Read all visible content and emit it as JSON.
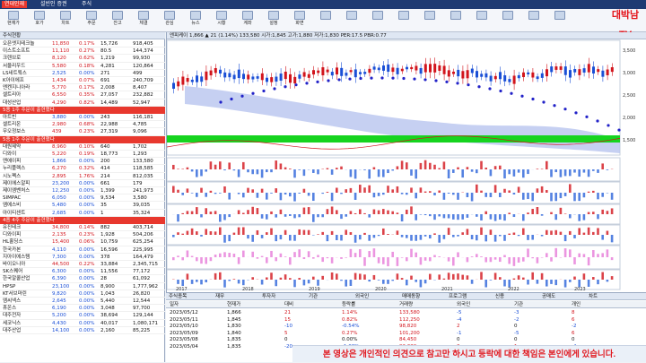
{
  "title_tabs": [
    "연대인재",
    "설빈인 증권",
    "주식",
    "",
    "",
    "",
    "",
    "",
    "",
    ""
  ],
  "toolbar": {
    "items": [
      "현재가",
      "호가",
      "차트",
      "주문",
      "잔고",
      "체결",
      "관심",
      "뉴스",
      "시황",
      "계좌",
      "설정",
      "화면",
      "",
      "",
      "",
      "",
      "",
      "",
      "",
      "",
      "",
      ""
    ]
  },
  "logo": "대박남TV",
  "left_panel": {
    "header": "주식현황",
    "rows": [
      {
        "name": "오픈엣지테크놀",
        "price": "11,850",
        "rate": "0.17%",
        "vol": "15,726",
        "amt": "918,405",
        "dir": "up"
      },
      {
        "name": "이스트소프트",
        "price": "11,110",
        "rate": "0.27%",
        "vol": "80.5",
        "amt": "144,374",
        "dir": "up"
      },
      {
        "name": "크렌브로",
        "price": "8,120",
        "rate": "0.62%",
        "vol": "1,219",
        "amt": "99,930",
        "dir": "up"
      },
      {
        "name": "서울리우드",
        "price": "5,580",
        "rate": "0.18%",
        "vol": "4,281",
        "amt": "120,864",
        "dir": "up"
      },
      {
        "name": "LS네트웍스",
        "price": "2,525",
        "price_dir": "dn",
        "rate": "0.00%",
        "vol": "271",
        "amt": "499",
        "dir": "dn"
      },
      {
        "name": "K아이에프",
        "price": "1,434",
        "rate": "0.07%",
        "vol": "691",
        "amt": "240,709",
        "dir": "up"
      },
      {
        "name": "엔켄지니아라",
        "price": "5,770",
        "rate": "0.17%",
        "vol": "2,008",
        "amt": "8,407",
        "dir": "up"
      },
      {
        "name": "셀트리아",
        "price": "6,550",
        "rate": "0.35%",
        "vol": "27,057",
        "amt": "232,882",
        "dir": "up"
      },
      {
        "name": "대성산업",
        "price": "4,290",
        "rate": "0.82%",
        "vol": "14,489",
        "amt": "52,947",
        "dir": "up"
      }
    ],
    "section1": "5종 1주 주문이 출현했다",
    "rows2": [
      {
        "name": "아트빈",
        "price": "3,880",
        "rate": "0.00%",
        "vol": "243",
        "amt": "116,181",
        "dir": "dn"
      },
      {
        "name": "셀트리온",
        "price": "2,980",
        "rate": "0.68%",
        "vol": "22,988",
        "amt": "4,785",
        "dir": "up"
      },
      {
        "name": "무오정보스",
        "price": "439",
        "rate": "0.23%",
        "vol": "27,319",
        "amt": "9,096",
        "dir": "up"
      }
    ],
    "section2": "5종 1주 주문이 출현했다",
    "rows3": [
      {
        "name": "대원제약",
        "price": "8,960",
        "rate": "0.10%",
        "vol": "640",
        "amt": "1,702",
        "dir": "up"
      },
      {
        "name": "디와이",
        "price": "5,220",
        "rate": "0.19%",
        "vol": "18,773",
        "amt": "1,293",
        "dir": "up"
      },
      {
        "name": "엔에이피",
        "price": "1,866",
        "rate": "0.00%",
        "vol": "200",
        "amt": "133,580",
        "dir": "dn"
      },
      {
        "name": "누리플렉스",
        "price": "6,270",
        "rate": "0.32%",
        "vol": "414",
        "amt": "118,585",
        "dir": "up"
      },
      {
        "name": "시노펙스",
        "price": "2,895",
        "rate": "1.76%",
        "vol": "214",
        "amt": "812,035",
        "dir": "up"
      },
      {
        "name": "제이에스알피",
        "price": "23,200",
        "rate": "0.00%",
        "vol": "661",
        "amt": "179",
        "dir": "dn"
      },
      {
        "name": "제이엠벤처스",
        "price": "12,250",
        "rate": "0.00%",
        "vol": "1,399",
        "amt": "241,973",
        "dir": "dn"
      },
      {
        "name": "SIMPAC",
        "price": "6,050",
        "rate": "0.00%",
        "vol": "9,534",
        "amt": "3,580",
        "dir": "dn"
      },
      {
        "name": "엠에스비",
        "price": "5,480",
        "rate": "0.00%",
        "vol": "35",
        "amt": "39,035",
        "dir": "dn"
      },
      {
        "name": "아이티센트",
        "price": "2,685",
        "rate": "0.00%",
        "vol": "1",
        "amt": "35,324",
        "dir": "dn"
      }
    ],
    "section3": "4종 4주 주문이 출현했다",
    "rows4": [
      {
        "name": "유진테크",
        "price": "34,800",
        "rate": "0.14%",
        "vol": "882",
        "amt": "403,714",
        "dir": "up"
      },
      {
        "name": "디와이피",
        "price": "2,135",
        "rate": "0.23%",
        "vol": "1,928",
        "amt": "504,206",
        "dir": "up"
      },
      {
        "name": "HL홀딩스",
        "price": "15,400",
        "rate": "0.06%",
        "vol": "10,759",
        "amt": "625,254",
        "dir": "up"
      },
      {
        "name": "한국카본",
        "price": "4,110",
        "rate": "0.00%",
        "vol": "16,596",
        "amt": "225,995",
        "dir": "dn"
      },
      {
        "name": "지아이에스템",
        "price": "7,300",
        "rate": "0.00%",
        "vol": "378",
        "amt": "164,479",
        "dir": "dn"
      }
    ],
    "rows5": [
      {
        "name": "바이오니아",
        "price": "44,500",
        "rate": "0.22%",
        "vol": "33,884",
        "amt": "2,345,715",
        "dir": "up"
      },
      {
        "name": "SK스퀘어",
        "price": "6,300",
        "rate": "0.00%",
        "vol": "11,556",
        "amt": "77,172",
        "dir": "dn"
      },
      {
        "name": "한국알콜산업",
        "price": "6,390",
        "rate": "0.00%",
        "vol": "28",
        "amt": "61,092",
        "dir": "dn"
      },
      {
        "name": "HPSP",
        "price": "23,100",
        "rate": "0.00%",
        "vol": "8,900",
        "amt": "1,777,962",
        "dir": "dn"
      },
      {
        "name": "KT서브마린",
        "price": "9,820",
        "rate": "0.00%",
        "vol": "1,043",
        "amt": "26,820",
        "dir": "dn"
      },
      {
        "name": "엠씨넥스",
        "price": "2,645",
        "rate": "0.00%",
        "vol": "5,440",
        "amt": "12,544",
        "dir": "dn"
      },
      {
        "name": "휴온스",
        "price": "6,190",
        "rate": "0.00%",
        "vol": "3,048",
        "amt": "97,700",
        "dir": "dn"
      },
      {
        "name": "대주전자",
        "price": "5,200",
        "rate": "0.00%",
        "vol": "38,694",
        "amt": "129,144",
        "dir": "dn"
      },
      {
        "name": "세코닉스",
        "price": "4,430",
        "rate": "0.00%",
        "vol": "40,017",
        "amt": "1,080,171",
        "dir": "dn"
      },
      {
        "name": "대주산업",
        "price": "14,100",
        "rate": "0.00%",
        "vol": "2,160",
        "amt": "85,225",
        "dir": "dn"
      }
    ]
  },
  "chart": {
    "header": "엔피케이  1,866  ▲ 21 (1.14%)  133,580  시가:1,845  고가:1,880  저가:1,830  PER:17.5  PBR:0.77",
    "y_labels": [
      "3,500",
      "3,000",
      "2,500",
      "2,000",
      "1,500"
    ],
    "x_labels": [
      "2017",
      "2018",
      "2019",
      "2020",
      "2021",
      "2022",
      "2023"
    ]
  },
  "bottom": {
    "tabs": [
      "주식종목",
      "재무",
      "투자자",
      "기관",
      "외국인",
      "매매동향",
      "프로그램",
      "신용",
      "공매도",
      "차트"
    ],
    "columns": [
      "일자",
      "현재가",
      "대비",
      "등락률",
      "거래량",
      "외국인",
      "기관",
      "개인"
    ],
    "rows": [
      [
        "2023/05/12",
        "1,866",
        "21",
        "1.14%",
        "133,580",
        "-5",
        "-3",
        "8"
      ],
      [
        "2023/05/11",
        "1,845",
        "15",
        "0.82%",
        "112,250",
        "-4",
        "-2",
        "6"
      ],
      [
        "2023/05/10",
        "1,830",
        "-10",
        "-0.54%",
        "98,820",
        "2",
        "0",
        "-2"
      ],
      [
        "2023/05/09",
        "1,840",
        "5",
        "0.27%",
        "101,200",
        "-1",
        "-5",
        "6"
      ],
      [
        "2023/05/08",
        "1,835",
        "0",
        "0.00%",
        "84,450",
        "0",
        "0",
        "0"
      ],
      [
        "2023/05/04",
        "1,835",
        "-20",
        "-1.08%",
        "92,330",
        "3",
        "1",
        "-4"
      ]
    ]
  },
  "subtitle": "본 영상은 개인적인 의견으로 참고만 하시고 등락에 대한 책임은 본인에게 있습니다."
}
